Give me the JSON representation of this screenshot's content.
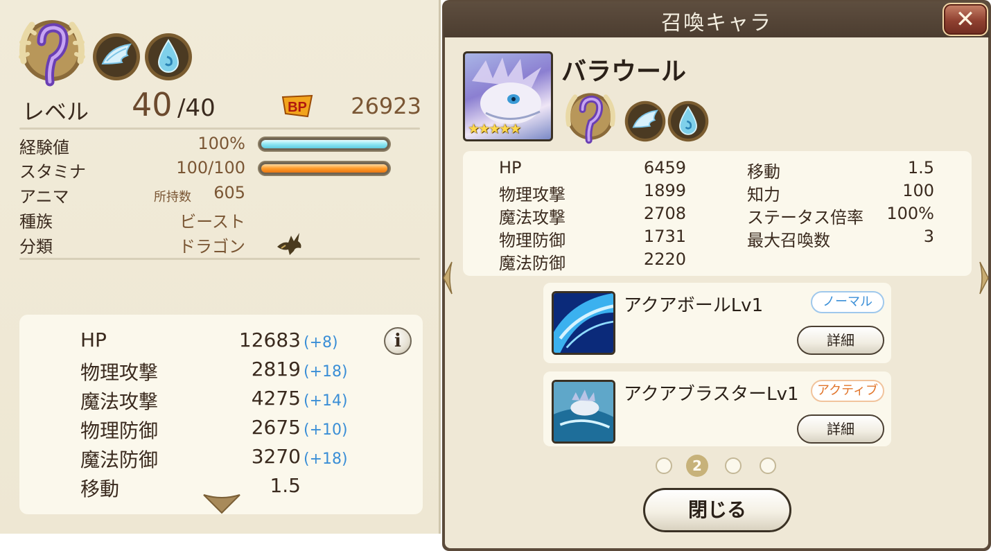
{
  "left": {
    "level_label": "レベル",
    "level_current": "40",
    "level_max": "/40",
    "bp_icon": "bp-badge-icon",
    "bp_value": "26923",
    "exp_label": "経験値",
    "exp_value": "100%",
    "exp_fill": 1.0,
    "stamina_label": "スタミナ",
    "stamina_value": "100/100",
    "stamina_fill": 1.0,
    "anima_label": "アニマ",
    "anima_sub": "所持数",
    "anima_value": "605",
    "race_label": "種族",
    "race_value": "ビースト",
    "class_label": "分類",
    "class_value": "ドラゴン",
    "stats": [
      {
        "label": "HP",
        "value": "12683",
        "bonus": "(+8)"
      },
      {
        "label": "物理攻撃",
        "value": "2819",
        "bonus": "(+18)"
      },
      {
        "label": "魔法攻撃",
        "value": "4275",
        "bonus": "(+14)"
      },
      {
        "label": "物理防御",
        "value": "2675",
        "bonus": "(+10)"
      },
      {
        "label": "魔法防御",
        "value": "3270",
        "bonus": "(+18)"
      },
      {
        "label": "移動",
        "value": "1.5",
        "bonus": ""
      }
    ],
    "info_button": "i"
  },
  "dialog": {
    "title": "召喚キャラ",
    "close_x": "✕",
    "char_name": "バラウール",
    "stars": "★★★★★",
    "stats_left": [
      {
        "label": "HP",
        "value": "6459"
      },
      {
        "label": "物理攻撃",
        "value": "1899"
      },
      {
        "label": "魔法攻撃",
        "value": "2708"
      },
      {
        "label": "物理防御",
        "value": "1731"
      },
      {
        "label": "魔法防御",
        "value": "2220"
      }
    ],
    "stats_right": [
      {
        "label": "移動",
        "value": "1.5"
      },
      {
        "label": "知力",
        "value": "100"
      },
      {
        "label": "ステータス倍率",
        "value": "100%"
      },
      {
        "label": "最大召喚数",
        "value": "3"
      }
    ],
    "skills": [
      {
        "name": "アクアボールLv1",
        "tag": "ノーマル",
        "detail": "詳細"
      },
      {
        "name": "アクアブラスターLv1",
        "tag": "アクティブ",
        "detail": "詳細"
      }
    ],
    "pagination": {
      "current": "2",
      "total": 4
    },
    "close_button": "閉じる"
  },
  "colors": {
    "panel_bg": "#efe8d6",
    "card_bg": "#fbf8ec",
    "header_bg": "#4c3d30",
    "bonus_blue": "#3a8ed6",
    "value_brown": "#7a5634",
    "normal_tag": "#3b8fd7",
    "active_tag": "#e1742a"
  }
}
